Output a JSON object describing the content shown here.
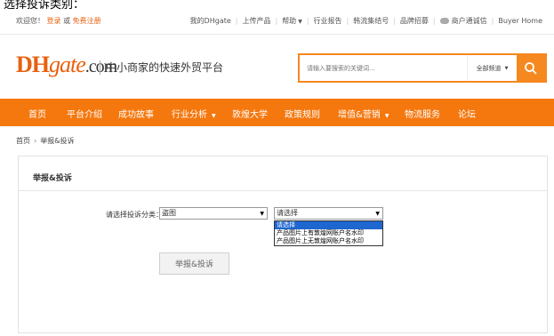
{
  "page_heading": "选择投诉类别：",
  "topbar": {
    "welcome": "欢迎您！",
    "login": "登录",
    "or": "或",
    "register": "免费注册",
    "links": [
      {
        "label": "我的DHgate",
        "caret": false
      },
      {
        "label": "上传产品",
        "caret": false
      },
      {
        "label": "帮助",
        "caret": true
      },
      {
        "label": "行业报告",
        "caret": false
      },
      {
        "label": "韩流集结号",
        "caret": false
      },
      {
        "label": "品牌招募",
        "caret": false
      },
      {
        "label": "商户通诚信",
        "caret": false,
        "icon": "qq-icon"
      },
      {
        "label": "Buyer Home",
        "caret": false
      }
    ]
  },
  "logo": {
    "dh": "DH",
    "gate": "gate",
    "com": ".com"
  },
  "tagline": "中小商家的快速外贸平台",
  "search": {
    "placeholder": "请输入要搜索的关键词...",
    "scope": "全部频道",
    "button_icon": "search-icon"
  },
  "nav": {
    "items": [
      {
        "label": "首页",
        "caret": false
      },
      {
        "label": "平台介绍",
        "caret": false
      },
      {
        "label": "成功故事",
        "caret": false
      },
      {
        "label": "行业分析",
        "caret": true
      },
      {
        "label": "敦煌大学",
        "caret": false
      },
      {
        "label": "政策规则",
        "caret": false
      },
      {
        "label": "增值&营销",
        "caret": true
      },
      {
        "label": "物流服务",
        "caret": false
      },
      {
        "label": "论坛",
        "caret": false
      }
    ]
  },
  "breadcrumb": {
    "home": "首页",
    "current": "举报&投诉"
  },
  "panel": {
    "title": "举报&投诉",
    "form_label": "请选择投诉分类：",
    "category_select": "盗图",
    "subcategory_select": "请选择",
    "subcategory_options": [
      "请选择",
      "产品图片上有敦煌网账户名水印",
      "产品图片上无敦煌网账户名水印"
    ],
    "submit": "举报&投诉"
  },
  "colors": {
    "brand_orange": "#f5780f",
    "selected_option": "#1e66d0"
  }
}
